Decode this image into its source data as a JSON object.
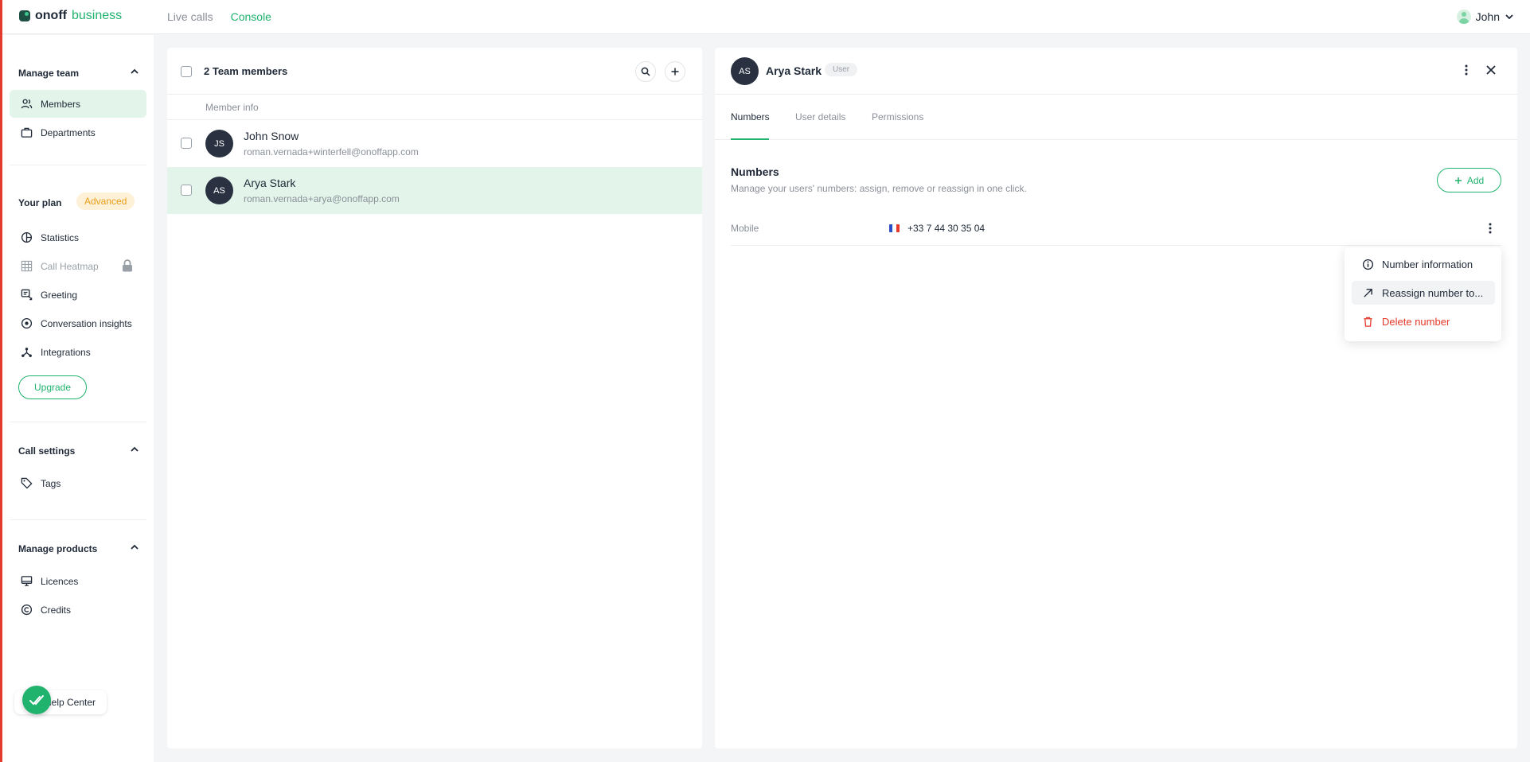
{
  "app": {
    "brand_main": "onoff",
    "brand_sub": "business"
  },
  "topnav": {
    "live_calls": "Live calls",
    "console": "Console"
  },
  "user": {
    "name": "John"
  },
  "sidebar": {
    "manage_team": "Manage team",
    "members": "Members",
    "departments": "Departments",
    "your_plan": "Your plan",
    "plan_badge": "Advanced",
    "statistics": "Statistics",
    "call_heatmap": "Call Heatmap",
    "greeting": "Greeting",
    "conversation_insights": "Conversation insights",
    "integrations": "Integrations",
    "upgrade": "Upgrade",
    "call_settings": "Call settings",
    "tags": "Tags",
    "manage_products": "Manage products",
    "licences": "Licences",
    "credits": "Credits",
    "help_center": "Help Center"
  },
  "members_panel": {
    "title": "2 Team members",
    "column_header": "Member info",
    "rows": [
      {
        "initials": "JS",
        "name": "John Snow",
        "email": "roman.vernada+winterfell@onoffapp.com"
      },
      {
        "initials": "AS",
        "name": "Arya Stark",
        "email": "roman.vernada+arya@onoffapp.com"
      }
    ]
  },
  "detail": {
    "initials": "AS",
    "name": "Arya Stark",
    "role": "User",
    "tabs": [
      "Numbers",
      "User details",
      "Permissions"
    ],
    "numbers_title": "Numbers",
    "numbers_desc": "Manage your users' numbers: assign, remove or reassign in one click.",
    "add_label": "Add",
    "number_row": {
      "type": "Mobile",
      "number": "+33 7 44 30 35 04",
      "country": "France"
    },
    "menu": {
      "info": "Number information",
      "reassign": "Reassign number to...",
      "delete": "Delete number"
    }
  },
  "colors": {
    "accent": "#20b36e",
    "danger": "#e5392b",
    "selected_bg": "#e3f5ea",
    "badge_text": "#e79d1a"
  }
}
